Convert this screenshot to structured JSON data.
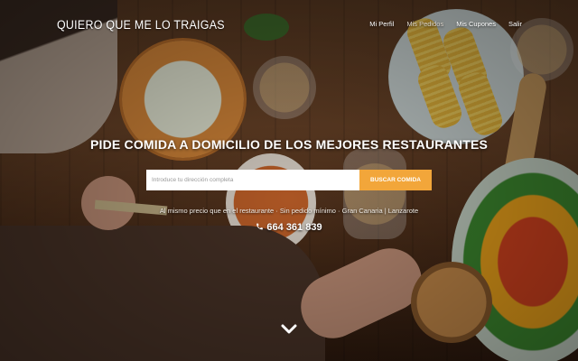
{
  "header": {
    "brand": "QUIERO QUE ME LO TRAIGAS",
    "nav": [
      {
        "label": "Mi Perfil"
      },
      {
        "label": "Mis Pedidos"
      },
      {
        "label": "Mis Cupones"
      },
      {
        "label": "Salir"
      }
    ]
  },
  "hero": {
    "title": "PIDE COMIDA A DOMICILIO DE LOS MEJORES RESTAURANTES",
    "search": {
      "placeholder": "Introduce tu dirección completa",
      "value": "",
      "button_label": "BUSCAR COMIDA"
    },
    "tagline": "Al mismo precio que en el restaurante · Sin pedido mínimo · Gran Canaria | Lanzarote",
    "phone": "664 361 839",
    "icons": {
      "phone": "phone-icon",
      "scroll": "chevron-down-icon"
    }
  },
  "colors": {
    "accent": "#f2a63a",
    "text": "#ffffff",
    "nav_dim": "#d9d2c8"
  }
}
